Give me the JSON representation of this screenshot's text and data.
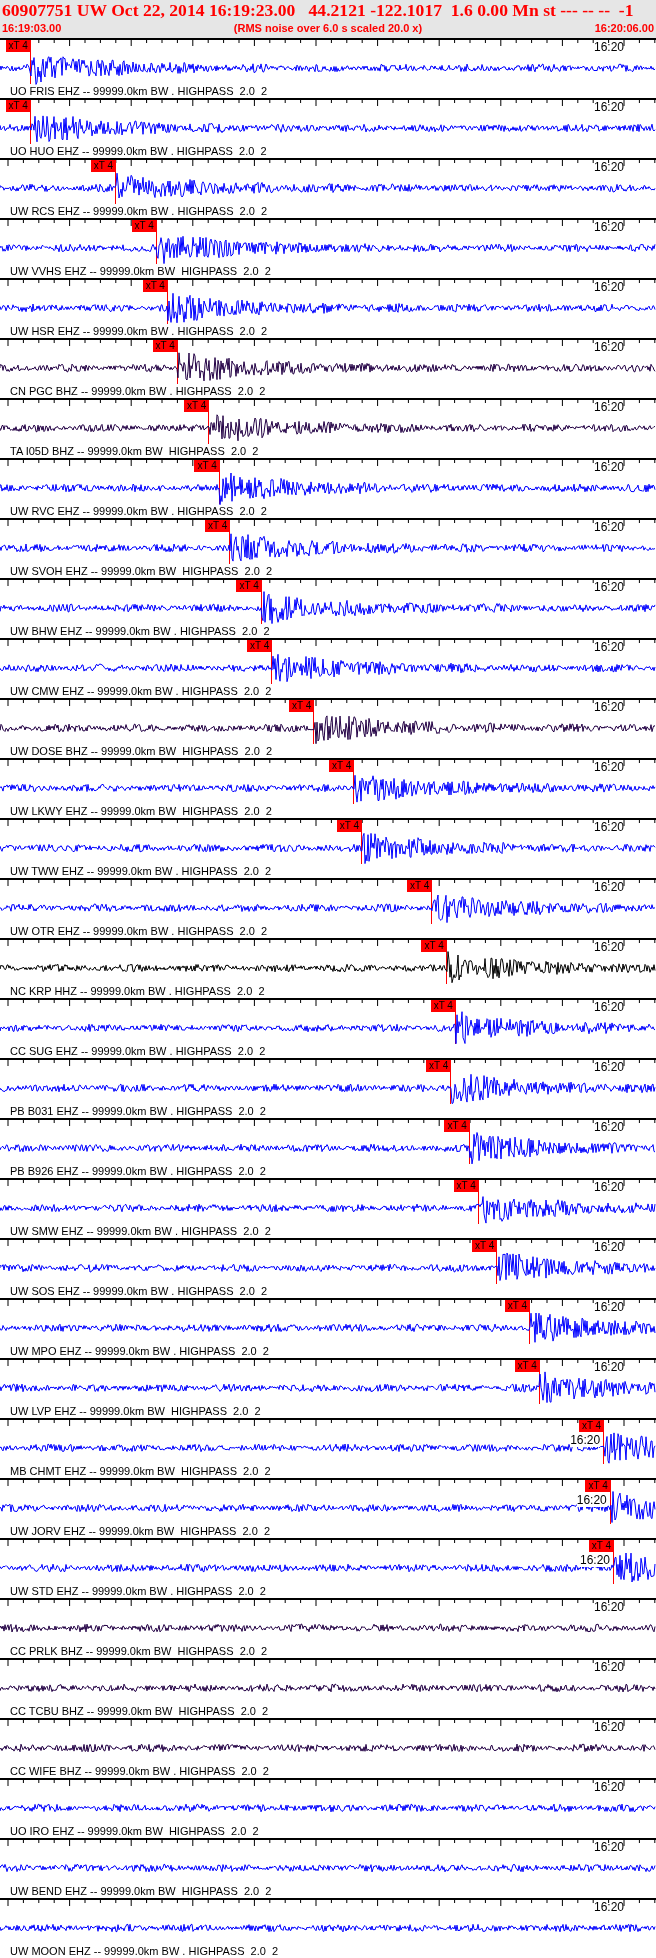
{
  "header": {
    "title": "60907751 UW Oct 22, 2014 16:19:23.00   44.2121 -122.1017  1.6 0.00 Mn st --- -- --  -1",
    "start_time": "16:19:03.00",
    "note": "(RMS noise over 6.0 s scaled 20.0 x)",
    "end_time": "16:20:06.00"
  },
  "traces": [
    {
      "label": "UO FRIS EHZ -- 99999.0km BW . HIGHPASS  2.0  2",
      "time_mark": "16:20",
      "color": "#0000ff",
      "pick": {
        "label": "xT 4",
        "level": 0.047
      }
    },
    {
      "label": "UO HUO EHZ -- 99999.0km BW . HIGHPASS  2.0  2",
      "time_mark": "16:20",
      "color": "#0000ff",
      "pick": {
        "label": "xT 4",
        "level": 0.047
      }
    },
    {
      "label": "UW RCS EHZ -- 99999.0km BW . HIGHPASS  2.0  2",
      "time_mark": "16:20",
      "color": "#0000ff",
      "pick": {
        "label": "xT 4",
        "level": 0.177
      }
    },
    {
      "label": "UW VVHS EHZ -- 99999.0km BW  HIGHPASS  2.0  2",
      "time_mark": "16:20",
      "color": "#0000ff",
      "pick": {
        "label": "xT 4",
        "level": 0.239
      }
    },
    {
      "label": "UW HSR EHZ -- 99999.0km BW . HIGHPASS  2.0  2",
      "time_mark": "16:20",
      "color": "#0000ff",
      "pick": {
        "label": "xT 4",
        "level": 0.256
      }
    },
    {
      "label": "CN PGC BHZ -- 99999.0km BW . HIGHPASS  2.0  2",
      "time_mark": "16:20",
      "color": "#220044",
      "pick": {
        "label": "xT 4",
        "level": 0.271
      }
    },
    {
      "label": "TA I05D BHZ -- 99999.0km BW  HIGHPASS  2.0  2",
      "time_mark": "16:20",
      "color": "#220044",
      "pick": {
        "label": "xT 4",
        "level": 0.319
      }
    },
    {
      "label": "UW RVC EHZ -- 99999.0km BW . HIGHPASS  2.0  2",
      "time_mark": "16:20",
      "color": "#0000ff",
      "pick": {
        "label": "xT 4",
        "level": 0.335
      }
    },
    {
      "label": "UW SVOH EHZ -- 99999.0km BW  HIGHPASS  2.0  2",
      "time_mark": "16:20",
      "color": "#0000ff",
      "pick": {
        "label": "xT 4",
        "level": 0.351
      }
    },
    {
      "label": "UW BHW EHZ -- 99999.0km BW . HIGHPASS  2.0  2",
      "time_mark": "16:20",
      "color": "#0000ff",
      "pick": {
        "label": "xT 4",
        "level": 0.399
      }
    },
    {
      "label": "UW CMW EHZ -- 99999.0km BW . HIGHPASS  2.0  2",
      "time_mark": "16:20",
      "color": "#0000ff",
      "pick": {
        "label": "xT 4",
        "level": 0.415
      }
    },
    {
      "label": "UW DOSE BHZ -- 99999.0km BW  HIGHPASS  2.0  2",
      "time_mark": "16:20",
      "color": "#220044",
      "pick": {
        "label": "xT 4",
        "level": 0.479
      }
    },
    {
      "label": "UW LKWY EHZ -- 99999.0km BW  HIGHPASS  2.0  2",
      "time_mark": "16:20",
      "color": "#0000ff",
      "pick": {
        "label": "xT 4",
        "level": 0.54
      }
    },
    {
      "label": "UW TWW EHZ -- 99999.0km BW . HIGHPASS  2.0  2",
      "time_mark": "16:20",
      "color": "#0000ff",
      "pick": {
        "label": "xT 4",
        "level": 0.552
      }
    },
    {
      "label": "UW OTR EHZ -- 99999.0km BW . HIGHPASS  2.0  2",
      "time_mark": "16:20",
      "color": "#0000ff",
      "pick": {
        "label": "xT 4",
        "level": 0.659
      }
    },
    {
      "label": "NC KRP HHZ -- 99999.0km BW . HIGHPASS  2.0  2",
      "time_mark": "16:20",
      "color": "#000000",
      "pick": {
        "label": "xT 4",
        "level": 0.681
      }
    },
    {
      "label": "CC SUG EHZ -- 99999.0km BW . HIGHPASS  2.0  2",
      "time_mark": "16:20",
      "color": "#0000ff",
      "pick": {
        "label": "xT 4",
        "level": 0.695
      }
    },
    {
      "label": "PB B031 EHZ -- 99999.0km BW . HIGHPASS  2.0  2",
      "time_mark": "16:20",
      "color": "#0000ff",
      "pick": {
        "label": "xT 4",
        "level": 0.688
      }
    },
    {
      "label": "PB B926 EHZ -- 99999.0km BW . HIGHPASS  2.0  2",
      "time_mark": "16:20",
      "color": "#0000ff",
      "pick": {
        "label": "xT 4",
        "level": 0.716
      }
    },
    {
      "label": "UW SMW EHZ -- 99999.0km BW . HIGHPASS  2.0  2",
      "time_mark": "16:20",
      "color": "#0000ff",
      "pick": {
        "label": "xT 4",
        "level": 0.73
      }
    },
    {
      "label": "UW SOS EHZ -- 99999.0km BW . HIGHPASS  2.0  2",
      "time_mark": "16:20",
      "color": "#0000ff",
      "pick": {
        "label": "xT 4",
        "level": 0.758
      }
    },
    {
      "label": "UW MPO EHZ -- 99999.0km BW . HIGHPASS  2.0  2",
      "time_mark": "16:20",
      "color": "#0000ff",
      "pick": {
        "label": "xT 4",
        "level": 0.808
      }
    },
    {
      "label": "UW LVP EHZ -- 99999.0km BW  HIGHPASS  2.0  2",
      "time_mark": "16:20",
      "color": "#0000ff",
      "pick": {
        "label": "xT 4",
        "level": 0.823
      }
    },
    {
      "label": "MB CHMT EHZ -- 99999.0km BW  HIGHPASS  2.0  2",
      "time_mark": "16:20",
      "color": "#0000ff",
      "pick": {
        "label": "xT 4",
        "level": 0.921
      }
    },
    {
      "label": "UW JORV EHZ -- 99999.0km BW  HIGHPASS  2.0  2",
      "time_mark": "16:20",
      "color": "#0000ff",
      "pick": {
        "label": "xT 4",
        "level": 0.931
      }
    },
    {
      "label": "UW STD EHZ -- 99999.0km BW . HIGHPASS  2.0  2",
      "time_mark": "16:20",
      "color": "#0000ff",
      "pick": {
        "label": "xT 4",
        "level": 0.936
      }
    },
    {
      "label": "CC PRLK BHZ -- 99999.0km BW  HIGHPASS  2.0  2",
      "time_mark": "16:20",
      "color": "#220044"
    },
    {
      "label": "CC TCBU BHZ -- 99999.0km BW  HIGHPASS  2.0  2",
      "time_mark": "16:20",
      "color": "#220044"
    },
    {
      "label": "CC WIFE BHZ -- 99999.0km BW . HIGHPASS  2.0  2",
      "time_mark": "16:20",
      "color": "#220044"
    },
    {
      "label": "UO IRO EHZ -- 99999.0km BW  HIGHPASS  2.0  2",
      "time_mark": "16:20",
      "color": "#0000ff"
    },
    {
      "label": "UW BEND EHZ -- 99999.0km BW  HIGHPASS  2.0  2",
      "time_mark": "16:20",
      "color": "#0000ff"
    },
    {
      "label": "UW MOON EHZ -- 99999.0km BW . HIGHPASS  2.0  2",
      "time_mark": "16:20",
      "color": "#0000ff"
    }
  ]
}
